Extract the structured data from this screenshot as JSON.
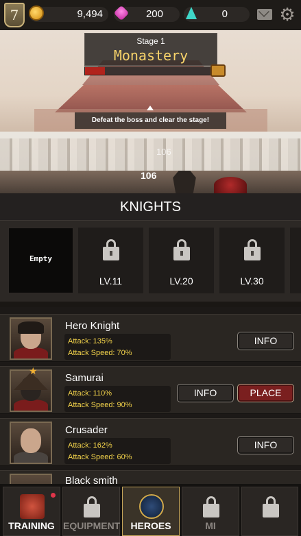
{
  "topbar": {
    "player_level": "7",
    "gold": "9,494",
    "gems": "200",
    "crystals": "0"
  },
  "stage": {
    "label": "Stage 1",
    "name": "Monastery",
    "boss_progress": 0.16,
    "hint": "Defeat the boss and clear the stage!",
    "damage_numbers": [
      "106",
      "106"
    ]
  },
  "knights": {
    "title": "KNIGHTS",
    "slots": [
      {
        "label": "Empty",
        "locked": false
      },
      {
        "label": "LV.11",
        "locked": true
      },
      {
        "label": "LV.20",
        "locked": true
      },
      {
        "label": "LV.30",
        "locked": true
      }
    ]
  },
  "heroes": [
    {
      "name": "Hero Knight",
      "attack": "Attack: 135%",
      "attack_speed": "Attack Speed: 70%",
      "info_label": "INFO"
    },
    {
      "name": "Samurai",
      "attack": "Attack: 110%",
      "attack_speed": "Attack Speed: 90%",
      "info_label": "INFO",
      "place_label": "PLACE"
    },
    {
      "name": "Crusader",
      "attack": "Attack: 162%",
      "attack_speed": "Attack Speed: 60%",
      "info_label": "INFO"
    },
    {
      "name": "Black smith"
    }
  ],
  "nav": {
    "tabs": [
      {
        "label": "TRAINING",
        "active": false,
        "locked": false
      },
      {
        "label": "EQUIPMENT",
        "active": false,
        "locked": true
      },
      {
        "label": "HEROES",
        "active": true,
        "locked": false
      },
      {
        "label": "MI",
        "active": false,
        "locked": true
      },
      {
        "label": "",
        "active": false,
        "locked": true
      }
    ]
  },
  "colors": {
    "accent_gold": "#f7d36a",
    "stat_yellow": "#f3d34b",
    "place_red": "#7a1f1f"
  }
}
